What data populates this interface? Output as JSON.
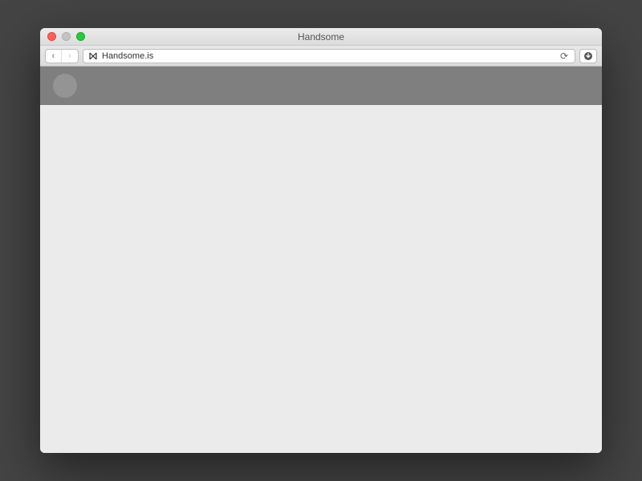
{
  "window": {
    "title": "Handsome"
  },
  "toolbar": {
    "url": "Handsome.is"
  }
}
